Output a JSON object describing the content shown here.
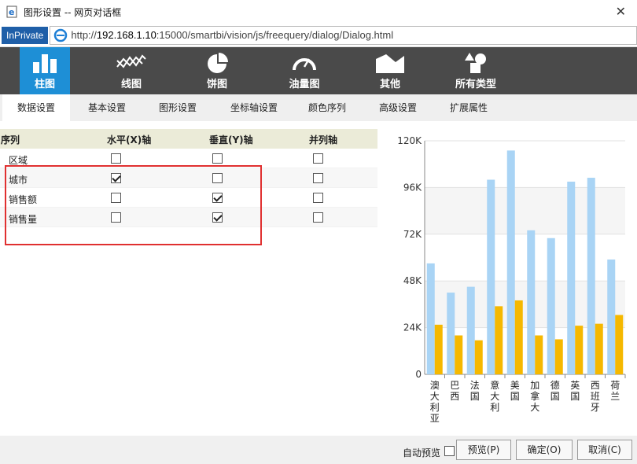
{
  "window": {
    "title": "图形设置 -- 网页对话框",
    "close_label": "✕"
  },
  "address": {
    "badge": "InPrivate",
    "url_prefix": "http://",
    "url_host": "192.168.1.10",
    "url_rest": ":15000/smartbi/vision/js/freequery/dialog/Dialog.html"
  },
  "chart_types": [
    {
      "label": "柱图",
      "active": true
    },
    {
      "label": "线图"
    },
    {
      "label": "饼图"
    },
    {
      "label": "油量图"
    },
    {
      "label": "其他"
    },
    {
      "label": "所有类型"
    }
  ],
  "tabs": [
    "数据设置",
    "基本设置",
    "图形设置",
    "坐标轴设置",
    "颜色序列",
    "高级设置",
    "扩展属性"
  ],
  "grid": {
    "headers": [
      "序列",
      "水平(X)轴",
      "垂直(Y)轴",
      "并列轴"
    ],
    "rows": [
      {
        "name": "区域",
        "x": false,
        "y": false,
        "p": false
      },
      {
        "name": "城市",
        "x": true,
        "y": false,
        "p": false
      },
      {
        "name": "销售额",
        "x": false,
        "y": true,
        "p": false
      },
      {
        "name": "销售量",
        "x": false,
        "y": true,
        "p": false
      }
    ]
  },
  "chart_data": {
    "type": "bar",
    "categories": [
      "澳大利亚",
      "巴西",
      "法国",
      "意大利",
      "美国",
      "加拿大",
      "德国",
      "英国",
      "西班牙",
      "荷兰"
    ],
    "series": [
      {
        "color": "#a9d4f5",
        "values": [
          57000,
          42000,
          45000,
          100000,
          115000,
          74000,
          70000,
          99000,
          101000,
          59000
        ]
      },
      {
        "color": "#f5b800",
        "values": [
          25500,
          20000,
          17500,
          35000,
          38000,
          20000,
          18000,
          25000,
          26000,
          30500
        ]
      }
    ],
    "yticks": [
      "0",
      "24K",
      "48K",
      "72K",
      "96K",
      "120K"
    ],
    "ylim": [
      0,
      120000
    ]
  },
  "footer": {
    "auto_preview": "自动预览",
    "preview": "预览(P)",
    "ok": "确定(O)",
    "cancel": "取消(C)"
  }
}
